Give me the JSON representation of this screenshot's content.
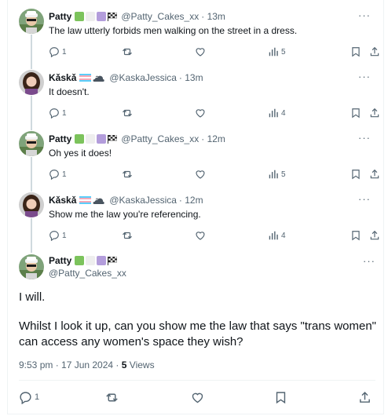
{
  "replies": [
    {
      "name": "Patty",
      "handle": "@Patty_Cakes_xx",
      "time": "· 13m",
      "text": "The law utterly forbids men walking on the street in a dress.",
      "reply_count": "1",
      "view_count": "5",
      "badges": [
        "green-square",
        "white-square",
        "purple-square",
        "checkered-flag"
      ]
    },
    {
      "name": "Kǎskǎ",
      "handle": "@KaskaJessica",
      "time": "· 13m",
      "text": "It doesn't.",
      "reply_count": "1",
      "view_count": "4",
      "badges": [
        "trans-flag",
        "cloud-with-bird"
      ]
    },
    {
      "name": "Patty",
      "handle": "@Patty_Cakes_xx",
      "time": "· 12m",
      "text": "Oh yes it does!",
      "reply_count": "1",
      "view_count": "5",
      "badges": [
        "green-square",
        "white-square",
        "purple-square",
        "checkered-flag"
      ]
    },
    {
      "name": "Kǎskǎ",
      "handle": "@KaskaJessica",
      "time": "· 12m",
      "text": "Show me the law you're referencing.",
      "reply_count": "1",
      "view_count": "4",
      "badges": [
        "trans-flag",
        "cloud-with-bird"
      ]
    }
  ],
  "main_tweet": {
    "name": "Patty",
    "handle": "@Patty_Cakes_xx",
    "text_1": "I will.",
    "text_2": "Whilst I look it up, can you show me the law that says \"trans women\" can access any women's space they wish?",
    "timestamp": "9:53 pm · 17 Jun 2024 ·",
    "views_count": "5",
    "views_label": "Views",
    "reply_count": "1"
  },
  "colors": {
    "text": "#0f1419",
    "secondary": "#536471",
    "thread_line": "#cfd9de",
    "badge_green": "#7cc35c",
    "badge_purple": "#b39ddb",
    "trans_blue": "#5bcefa",
    "trans_pink": "#f5a9b8"
  },
  "icons": [
    "more-icon",
    "reply-icon",
    "retweet-icon",
    "like-icon",
    "views-icon",
    "bookmark-icon",
    "share-icon"
  ]
}
